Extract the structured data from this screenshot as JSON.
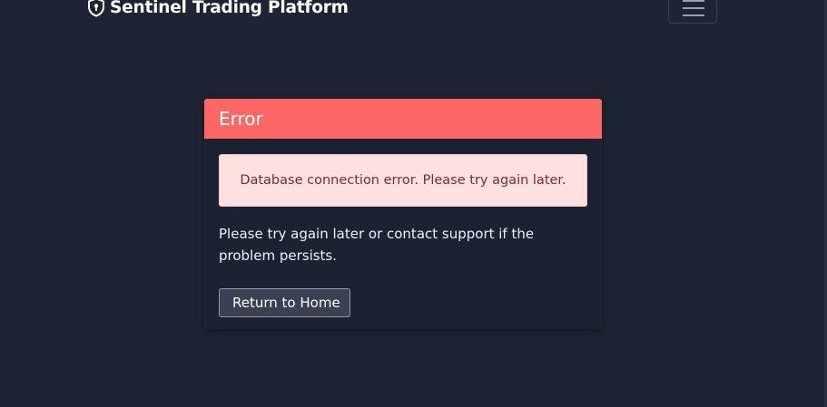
{
  "navbar": {
    "brand_text": "Sentinel Trading Platform",
    "brand_icon": "shield-lock-icon",
    "toggler_icon": "hamburger-menu-icon"
  },
  "card": {
    "title": "Error",
    "alert_text": "Database connection error. Please try again later.",
    "message": "Please try again later or contact support if the problem persists.",
    "button_label": "Return to Home"
  },
  "colors": {
    "background": "#1e2433",
    "card_background": "#1c2232",
    "header_red": "#ff6666",
    "alert_background": "#fde0e0",
    "alert_text": "#7a2c2c"
  }
}
